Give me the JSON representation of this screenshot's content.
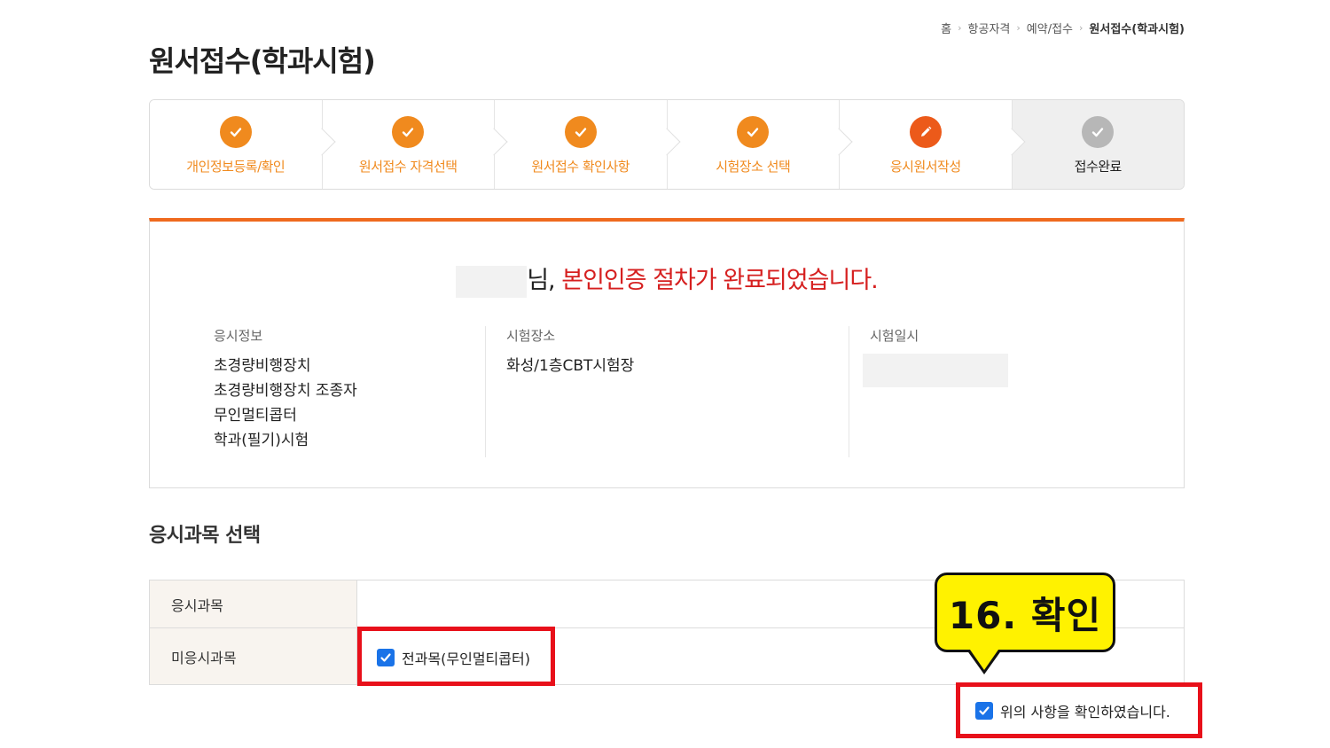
{
  "breadcrumb": {
    "items": [
      "홈",
      "항공자격",
      "예약/접수",
      "원서접수(학과시험)"
    ]
  },
  "page_title": "원서접수(학과시험)",
  "steps": [
    {
      "label": "개인정보등록/확인",
      "icon": "check-icon",
      "status": "done"
    },
    {
      "label": "원서접수 자격선택",
      "icon": "check-icon",
      "status": "done"
    },
    {
      "label": "원서접수 확인사항",
      "icon": "check-icon",
      "status": "done"
    },
    {
      "label": "시험장소 선택",
      "icon": "check-icon",
      "status": "done"
    },
    {
      "label": "응시원서작성",
      "icon": "pencil-icon",
      "status": "current"
    },
    {
      "label": "접수완료",
      "icon": "check-icon",
      "status": "pending"
    }
  ],
  "confirm": {
    "suffix": "님,",
    "message": "본인인증 절차가 완료되었습니다.",
    "exam_info_label": "응시정보",
    "exam_info_lines": [
      "초경량비행장치",
      "초경량비행장치 조종자",
      "무인멀티콥터",
      "학과(필기)시험"
    ],
    "place_label": "시험장소",
    "place_value": "화성/1층CBT시험장",
    "date_label": "시험일시"
  },
  "subject_section": {
    "title": "응시과목 선택",
    "row1_label": "응시과목",
    "row2_label": "미응시과목",
    "not_taken_option": "전과목(무인멀티콥터)",
    "not_taken_checked": true
  },
  "agreement": {
    "label": "위의 사항을 확인하였습니다.",
    "checked": true
  },
  "callout": {
    "text": "16. 확인"
  },
  "colors": {
    "accent_orange": "#f08a1e",
    "confirm_red": "#d62020",
    "highlight_red": "#e8101a",
    "callout_yellow": "#fff200",
    "checkbox_blue": "#1a73e8"
  }
}
